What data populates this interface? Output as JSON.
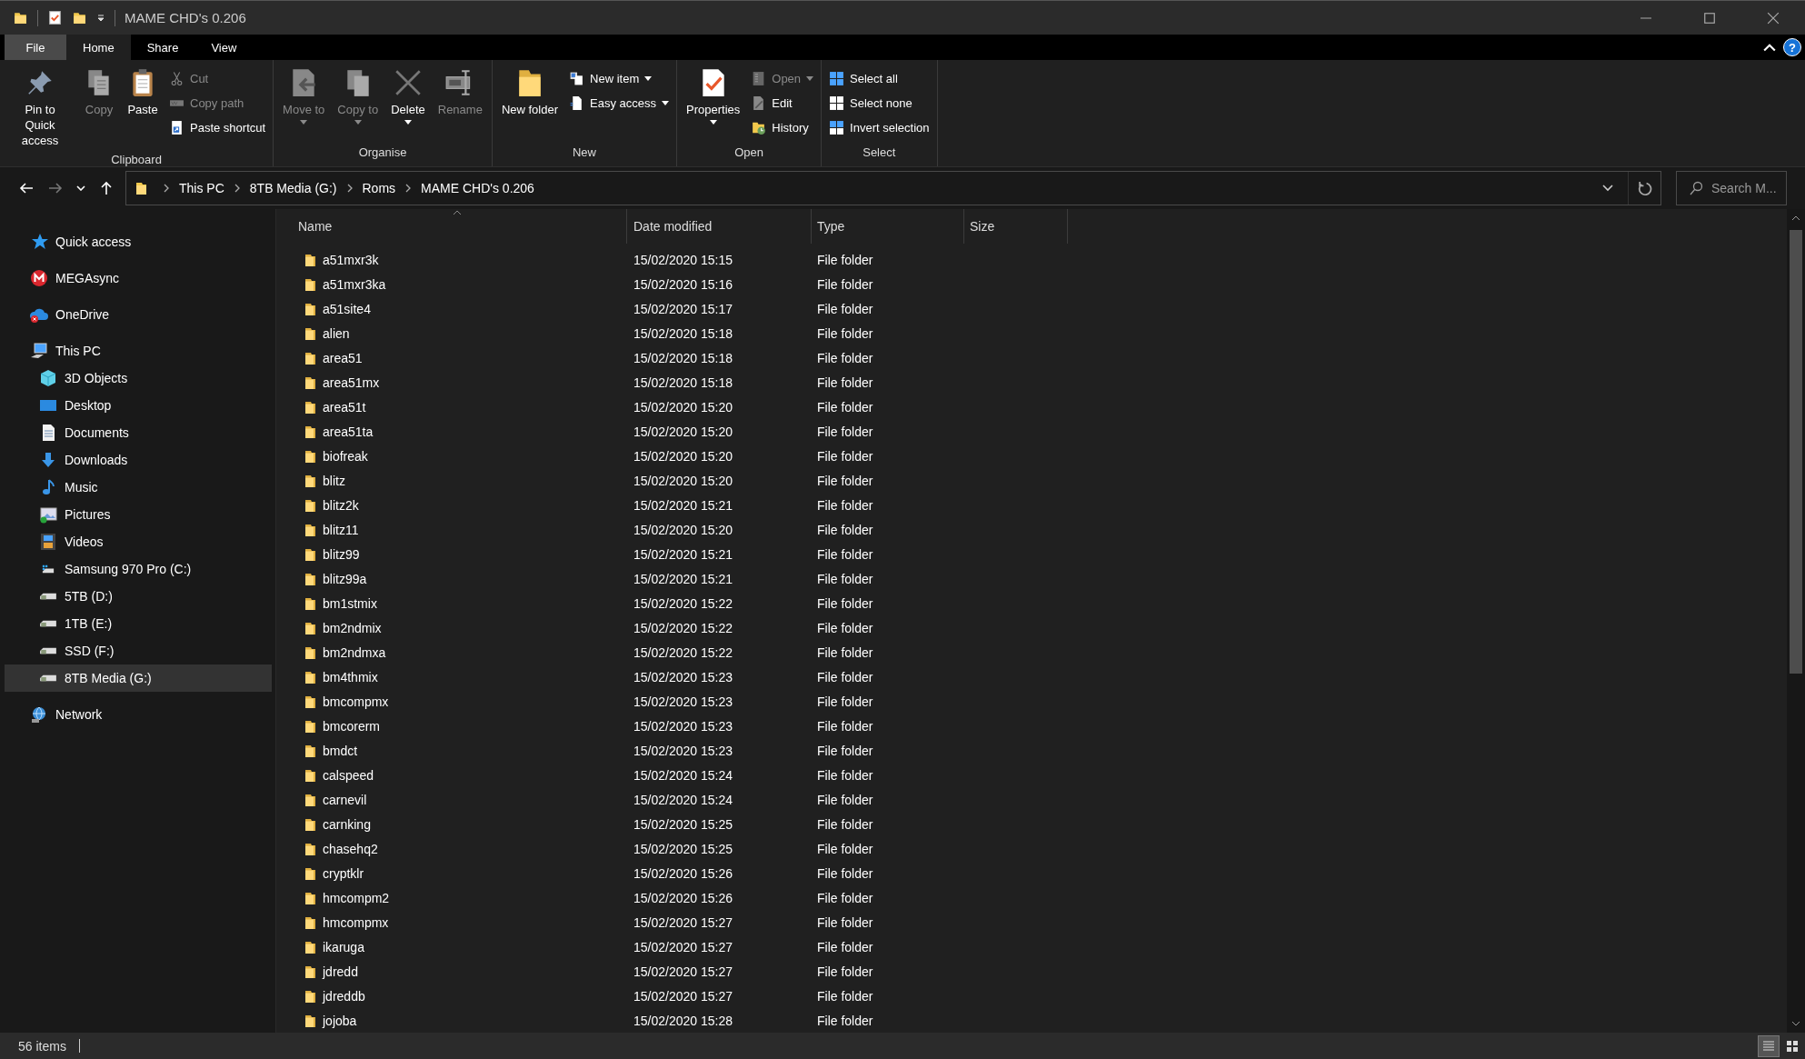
{
  "window": {
    "title": "MAME CHD's 0.206"
  },
  "tabs": [
    {
      "label": "File",
      "kind": "menu",
      "selected": false
    },
    {
      "label": "Home",
      "kind": "tab",
      "selected": true
    },
    {
      "label": "Share",
      "kind": "tab",
      "selected": false
    },
    {
      "label": "View",
      "kind": "tab",
      "selected": false
    }
  ],
  "help_button": "?",
  "ribbon": {
    "groups": [
      {
        "label": "Clipboard",
        "items": [
          {
            "label": "Pin to Quick access",
            "kind": "large",
            "disabled": false,
            "dropdown": false
          },
          {
            "label": "Copy",
            "kind": "large",
            "disabled": true,
            "dropdown": false
          },
          {
            "label": "Paste",
            "kind": "large",
            "disabled": false,
            "dropdown": false
          },
          {
            "label": "Cut",
            "kind": "small",
            "disabled": true,
            "dropdown": false
          },
          {
            "label": "Copy path",
            "kind": "small",
            "disabled": true,
            "dropdown": false
          },
          {
            "label": "Paste shortcut",
            "kind": "small",
            "disabled": false,
            "dropdown": false
          }
        ]
      },
      {
        "label": "Organise",
        "items": [
          {
            "label": "Move to",
            "kind": "large",
            "disabled": true,
            "dropdown": true
          },
          {
            "label": "Copy to",
            "kind": "large",
            "disabled": true,
            "dropdown": true
          },
          {
            "label": "Delete",
            "kind": "large",
            "disabled": false,
            "dropdown": true
          },
          {
            "label": "Rename",
            "kind": "large",
            "disabled": true,
            "dropdown": false
          }
        ]
      },
      {
        "label": "New",
        "items": [
          {
            "label": "New folder",
            "kind": "large",
            "disabled": false,
            "dropdown": false
          },
          {
            "label": "New item",
            "kind": "small",
            "disabled": false,
            "dropdown": true
          },
          {
            "label": "Easy access",
            "kind": "small",
            "disabled": false,
            "dropdown": true
          }
        ]
      },
      {
        "label": "Open",
        "items": [
          {
            "label": "Properties",
            "kind": "large",
            "disabled": false,
            "dropdown": true
          },
          {
            "label": "Open",
            "kind": "small",
            "disabled": true,
            "dropdown": true
          },
          {
            "label": "Edit",
            "kind": "small",
            "disabled": false,
            "dropdown": false
          },
          {
            "label": "History",
            "kind": "small",
            "disabled": false,
            "dropdown": false
          }
        ]
      },
      {
        "label": "Select",
        "items": [
          {
            "label": "Select all",
            "kind": "small",
            "disabled": false,
            "dropdown": false
          },
          {
            "label": "Select none",
            "kind": "small",
            "disabled": false,
            "dropdown": false
          },
          {
            "label": "Invert selection",
            "kind": "small",
            "disabled": false,
            "dropdown": false
          }
        ]
      }
    ]
  },
  "address": {
    "breadcrumbs": [
      "This PC",
      "8TB Media (G:)",
      "Roms",
      "MAME CHD's 0.206"
    ]
  },
  "search": {
    "placeholder": "Search M..."
  },
  "sidebar": {
    "items": [
      {
        "label": "Quick access",
        "selected": false
      },
      {
        "label": "MEGAsync",
        "selected": false
      },
      {
        "label": "OneDrive",
        "selected": false
      },
      {
        "label": "This PC",
        "selected": false,
        "children": [
          {
            "label": "3D Objects",
            "selected": false
          },
          {
            "label": "Desktop",
            "selected": false
          },
          {
            "label": "Documents",
            "selected": false
          },
          {
            "label": "Downloads",
            "selected": false
          },
          {
            "label": "Music",
            "selected": false
          },
          {
            "label": "Pictures",
            "selected": false
          },
          {
            "label": "Videos",
            "selected": false
          },
          {
            "label": "Samsung 970 Pro (C:)",
            "selected": false
          },
          {
            "label": "5TB (D:)",
            "selected": false
          },
          {
            "label": "1TB (E:)",
            "selected": false
          },
          {
            "label": "SSD (F:)",
            "selected": false
          },
          {
            "label": "8TB Media (G:)",
            "selected": true
          }
        ]
      },
      {
        "label": "Network",
        "selected": false
      }
    ]
  },
  "table": {
    "columns": [
      "Name",
      "Date modified",
      "Type",
      "Size"
    ],
    "rows": [
      {
        "name": "a51mxr3k",
        "date": "15/02/2020 15:15",
        "type": "File folder"
      },
      {
        "name": "a51mxr3ka",
        "date": "15/02/2020 15:16",
        "type": "File folder"
      },
      {
        "name": "a51site4",
        "date": "15/02/2020 15:17",
        "type": "File folder"
      },
      {
        "name": "alien",
        "date": "15/02/2020 15:18",
        "type": "File folder"
      },
      {
        "name": "area51",
        "date": "15/02/2020 15:18",
        "type": "File folder"
      },
      {
        "name": "area51mx",
        "date": "15/02/2020 15:18",
        "type": "File folder"
      },
      {
        "name": "area51t",
        "date": "15/02/2020 15:20",
        "type": "File folder"
      },
      {
        "name": "area51ta",
        "date": "15/02/2020 15:20",
        "type": "File folder"
      },
      {
        "name": "biofreak",
        "date": "15/02/2020 15:20",
        "type": "File folder"
      },
      {
        "name": "blitz",
        "date": "15/02/2020 15:20",
        "type": "File folder"
      },
      {
        "name": "blitz2k",
        "date": "15/02/2020 15:21",
        "type": "File folder"
      },
      {
        "name": "blitz11",
        "date": "15/02/2020 15:20",
        "type": "File folder"
      },
      {
        "name": "blitz99",
        "date": "15/02/2020 15:21",
        "type": "File folder"
      },
      {
        "name": "blitz99a",
        "date": "15/02/2020 15:21",
        "type": "File folder"
      },
      {
        "name": "bm1stmix",
        "date": "15/02/2020 15:22",
        "type": "File folder"
      },
      {
        "name": "bm2ndmix",
        "date": "15/02/2020 15:22",
        "type": "File folder"
      },
      {
        "name": "bm2ndmxa",
        "date": "15/02/2020 15:22",
        "type": "File folder"
      },
      {
        "name": "bm4thmix",
        "date": "15/02/2020 15:23",
        "type": "File folder"
      },
      {
        "name": "bmcompmx",
        "date": "15/02/2020 15:23",
        "type": "File folder"
      },
      {
        "name": "bmcorerm",
        "date": "15/02/2020 15:23",
        "type": "File folder"
      },
      {
        "name": "bmdct",
        "date": "15/02/2020 15:23",
        "type": "File folder"
      },
      {
        "name": "calspeed",
        "date": "15/02/2020 15:24",
        "type": "File folder"
      },
      {
        "name": "carnevil",
        "date": "15/02/2020 15:24",
        "type": "File folder"
      },
      {
        "name": "carnking",
        "date": "15/02/2020 15:25",
        "type": "File folder"
      },
      {
        "name": "chasehq2",
        "date": "15/02/2020 15:25",
        "type": "File folder"
      },
      {
        "name": "cryptklr",
        "date": "15/02/2020 15:26",
        "type": "File folder"
      },
      {
        "name": "hmcompm2",
        "date": "15/02/2020 15:26",
        "type": "File folder"
      },
      {
        "name": "hmcompmx",
        "date": "15/02/2020 15:27",
        "type": "File folder"
      },
      {
        "name": "ikaruga",
        "date": "15/02/2020 15:27",
        "type": "File folder"
      },
      {
        "name": "jdredd",
        "date": "15/02/2020 15:27",
        "type": "File folder"
      },
      {
        "name": "jdreddb",
        "date": "15/02/2020 15:27",
        "type": "File folder"
      },
      {
        "name": "jojoba",
        "date": "15/02/2020 15:28",
        "type": "File folder"
      }
    ]
  },
  "status_bar": {
    "item_count": "56 items"
  }
}
